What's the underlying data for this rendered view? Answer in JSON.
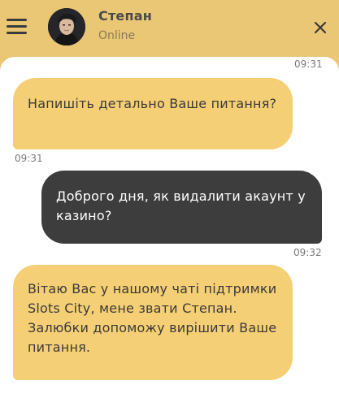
{
  "header": {
    "menu_icon": "hamburger-menu-icon",
    "agent_name": "Степан",
    "status": "Online",
    "close_icon": "close-icon"
  },
  "messages": [
    {
      "time_top": "09:31",
      "sender": "agent",
      "text": "Напишіть детально Ваше питання?",
      "time": "09:31"
    },
    {
      "sender": "user",
      "text": "Доброго дня, як видалити акаунт у казино?",
      "time": "09:32"
    },
    {
      "sender": "agent",
      "text": "Вітаю Вас у нашому чаті підтримки Slots City, мене звати Степан. Залюбки допоможу вирішити Ваше питання."
    }
  ],
  "colors": {
    "header_bg": "#e9c775",
    "agent_bubble": "#f5cf75",
    "user_bubble": "#3d3d3d",
    "chat_bg": "#ffffff"
  }
}
